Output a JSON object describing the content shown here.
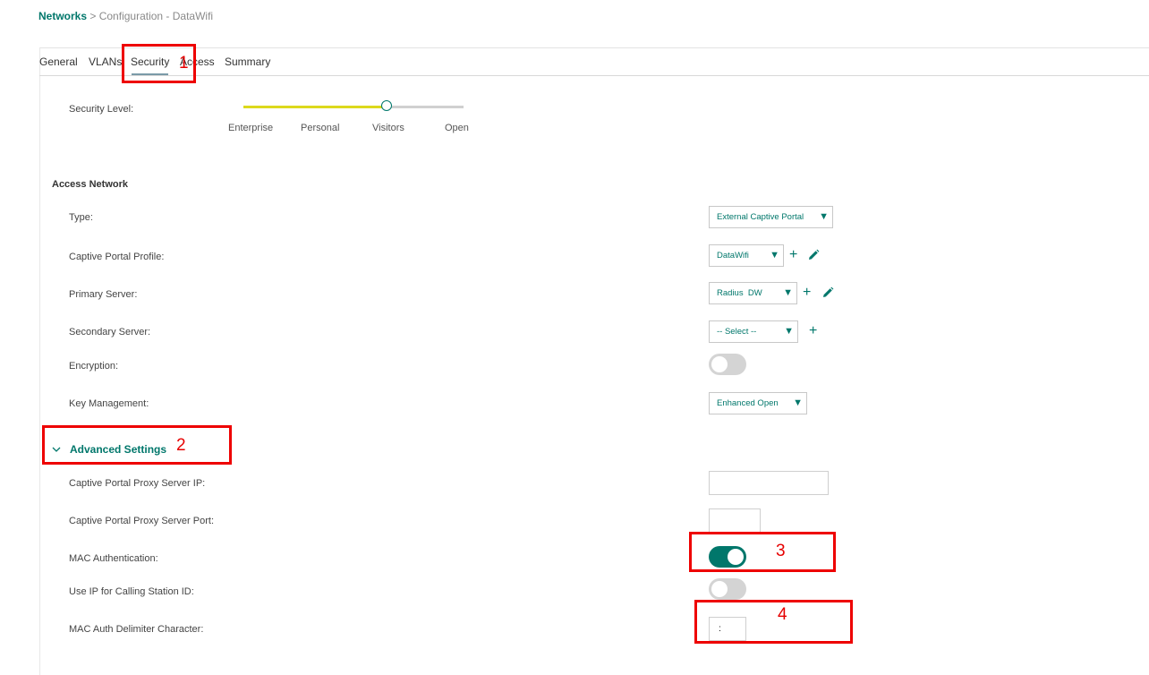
{
  "breadcrumb": {
    "root": "Networks",
    "separator": " > ",
    "current": "Configuration - DataWifi"
  },
  "tabs": [
    "General",
    "VLANs",
    "Security",
    "Access",
    "Summary"
  ],
  "security": {
    "level_label": "Security Level:",
    "levels": [
      "Enterprise",
      "Personal",
      "Visitors",
      "Open"
    ],
    "selected_level": "Visitors",
    "slider_value_percent": 65
  },
  "access_network": {
    "title": "Access Network",
    "type_label": "Type:",
    "type_value": "External Captive Portal",
    "captive_profile_label": "Captive Portal Profile:",
    "captive_profile_value": "DataWifi",
    "primary_server_label": "Primary Server:",
    "primary_server_value": "Radius  DW",
    "secondary_server_label": "Secondary Server:",
    "secondary_server_value": "-- Select --",
    "encryption_label": "Encryption:",
    "encryption_on": false,
    "key_mgmt_label": "Key Management:",
    "key_mgmt_value": "Enhanced Open"
  },
  "advanced": {
    "title": "Advanced Settings",
    "proxy_ip_label": "Captive Portal Proxy Server IP:",
    "proxy_ip_value": "",
    "proxy_port_label": "Captive Portal Proxy Server Port:",
    "proxy_port_value": "",
    "mac_auth_label": "MAC Authentication:",
    "mac_auth_on": true,
    "use_ip_label": "Use IP for Calling Station ID:",
    "use_ip_on": false,
    "delimiter_label": "MAC Auth Delimiter Character:",
    "delimiter_value": ":"
  },
  "annotations": [
    "1",
    "2",
    "3",
    "4"
  ],
  "colors": {
    "accent": "#00776b",
    "slider_fill": "#dcd91c",
    "annotation": "#ee0000"
  },
  "icons": {
    "add": "plus-icon",
    "edit": "pencil-icon",
    "dropdown": "triangle-down-icon",
    "expand": "chevron-down-icon"
  }
}
